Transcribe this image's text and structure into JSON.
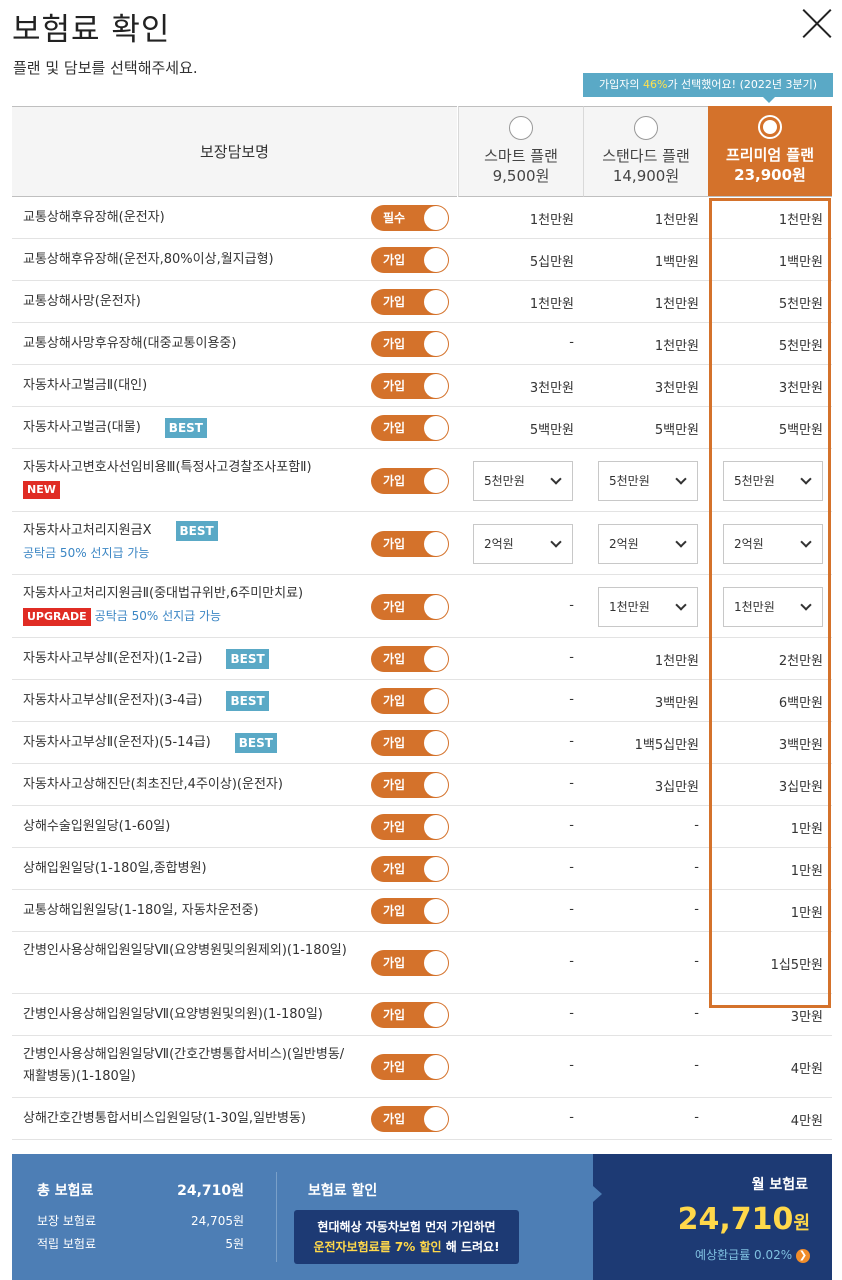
{
  "header": {
    "title": "보험료 확인",
    "subtitle": "플랜 및 담보를 선택해주세요.",
    "close_icon": "close-icon"
  },
  "notice": {
    "prefix": "가입자의 ",
    "highlight": "46%",
    "suffix": "가 선택했어요! ",
    "period": "(2022년 3분기)"
  },
  "table_header": {
    "name_label": "보장담보명",
    "plans": [
      {
        "name": "스마트 플랜",
        "price": "9,500원",
        "selected": false
      },
      {
        "name": "스탠다드 플랜",
        "price": "14,900원",
        "selected": false
      },
      {
        "name": "프리미엄 플랜",
        "price": "23,900원",
        "selected": true
      }
    ]
  },
  "rows": [
    {
      "name": "교통상해후유장해(운전자)",
      "toggle": "필수",
      "v1": "1천만원",
      "v2": "1천만원",
      "v3": "1천만원"
    },
    {
      "name": "교통상해후유장해(운전자,80%이상,월지급형)",
      "toggle": "가입",
      "v1": "5십만원",
      "v2": "1백만원",
      "v3": "1백만원"
    },
    {
      "name": "교통상해사망(운전자)",
      "toggle": "가입",
      "v1": "1천만원",
      "v2": "1천만원",
      "v3": "5천만원"
    },
    {
      "name": "교통상해사망후유장해(대중교통이용중)",
      "toggle": "가입",
      "v1": "-",
      "v2": "1천만원",
      "v3": "5천만원"
    },
    {
      "name": "자동차사고벌금Ⅱ(대인)",
      "toggle": "가입",
      "v1": "3천만원",
      "v2": "3천만원",
      "v3": "3천만원"
    },
    {
      "name": "자동차사고벌금(대물)",
      "badge": "BEST",
      "toggle": "가입",
      "v1": "5백만원",
      "v2": "5백만원",
      "v3": "5백만원"
    },
    {
      "name": "자동차사고변호사선임비용Ⅲ(특정사고경찰조사포함Ⅱ)",
      "badge_line2": "NEW",
      "toggle": "가입",
      "s1": "5천만원",
      "s2": "5천만원",
      "s3": "5천만원"
    },
    {
      "name": "자동차사고처리지원금Ⅹ",
      "badge": "BEST",
      "note": "공탁금 50% 선지급 가능",
      "toggle": "가입",
      "s1": "2억원",
      "s2": "2억원",
      "s3": "2억원"
    },
    {
      "name": "자동차사고처리지원금Ⅱ(중대법규위반,6주미만치료)",
      "badge_line2": "UPGRADE",
      "note": "공탁금 50% 선지급 가능",
      "toggle": "가입",
      "v1": "-",
      "s2": "1천만원",
      "s3": "1천만원"
    },
    {
      "name": "자동차사고부상Ⅱ(운전자)(1-2급)",
      "badge": "BEST",
      "toggle": "가입",
      "v1": "-",
      "v2": "1천만원",
      "v3": "2천만원"
    },
    {
      "name": "자동차사고부상Ⅱ(운전자)(3-4급)",
      "badge": "BEST",
      "toggle": "가입",
      "v1": "-",
      "v2": "3백만원",
      "v3": "6백만원"
    },
    {
      "name": "자동차사고부상Ⅱ(운전자)(5-14급)",
      "badge": "BEST",
      "toggle": "가입",
      "v1": "-",
      "v2": "1백5십만원",
      "v3": "3백만원"
    },
    {
      "name": "자동차사고상해진단(최초진단,4주이상)(운전자)",
      "toggle": "가입",
      "v1": "-",
      "v2": "3십만원",
      "v3": "3십만원"
    },
    {
      "name": "상해수술입원일당(1-60일)",
      "toggle": "가입",
      "v1": "-",
      "v2": "-",
      "v3": "1만원"
    },
    {
      "name": "상해입원일당(1-180일,종합병원)",
      "toggle": "가입",
      "v1": "-",
      "v2": "-",
      "v3": "1만원"
    },
    {
      "name": "교통상해입원일당(1-180일, 자동차운전중)",
      "toggle": "가입",
      "v1": "-",
      "v2": "-",
      "v3": "1만원"
    },
    {
      "name": "간병인사용상해입원일당Ⅶ(요양병원및의원제외)(1-180일)",
      "toggle": "가입",
      "v1": "-",
      "v2": "-",
      "v3": "1십5만원"
    },
    {
      "name": "간병인사용상해입원일당Ⅶ(요양병원및의원)(1-180일)",
      "toggle": "가입",
      "v1": "-",
      "v2": "-",
      "v3": "3만원"
    },
    {
      "name": "간병인사용상해입원일당Ⅶ(간호간병통합서비스)(일반병동/",
      "name2": "재활병동)(1-180일)",
      "toggle": "가입",
      "v1": "-",
      "v2": "-",
      "v3": "4만원"
    },
    {
      "name": "상해간호간병통합서비스입원일당(1-30일,일반병동)",
      "toggle": "가입",
      "v1": "-",
      "v2": "-",
      "v3": "4만원"
    }
  ],
  "footer": {
    "total_label": "총 보험료",
    "total_value": "24,710원",
    "coverage_label": "보장 보험료",
    "coverage_value": "24,705원",
    "saving_label": "적립 보험료",
    "saving_value": "5원",
    "discount_title": "보험료 할인",
    "discount_line1": "현대해상 자동차보험 먼저 가입하면",
    "discount_line2_hl": "운전자보험료를 7% 할인",
    "discount_line2_rest": " 해 드려요!",
    "monthly_label": "월 보험료",
    "monthly_value": "24,710",
    "monthly_unit": "원",
    "refund_label": "예상환급률 0.02%",
    "arrow_icon": "chevron-right-icon"
  },
  "colors": {
    "accent": "#d4722b",
    "blue": "#5aa9c6",
    "footer_blue": "#4d7eb5",
    "navy": "#1d3a74",
    "red": "#e02c24",
    "gold": "#ffd84a"
  }
}
